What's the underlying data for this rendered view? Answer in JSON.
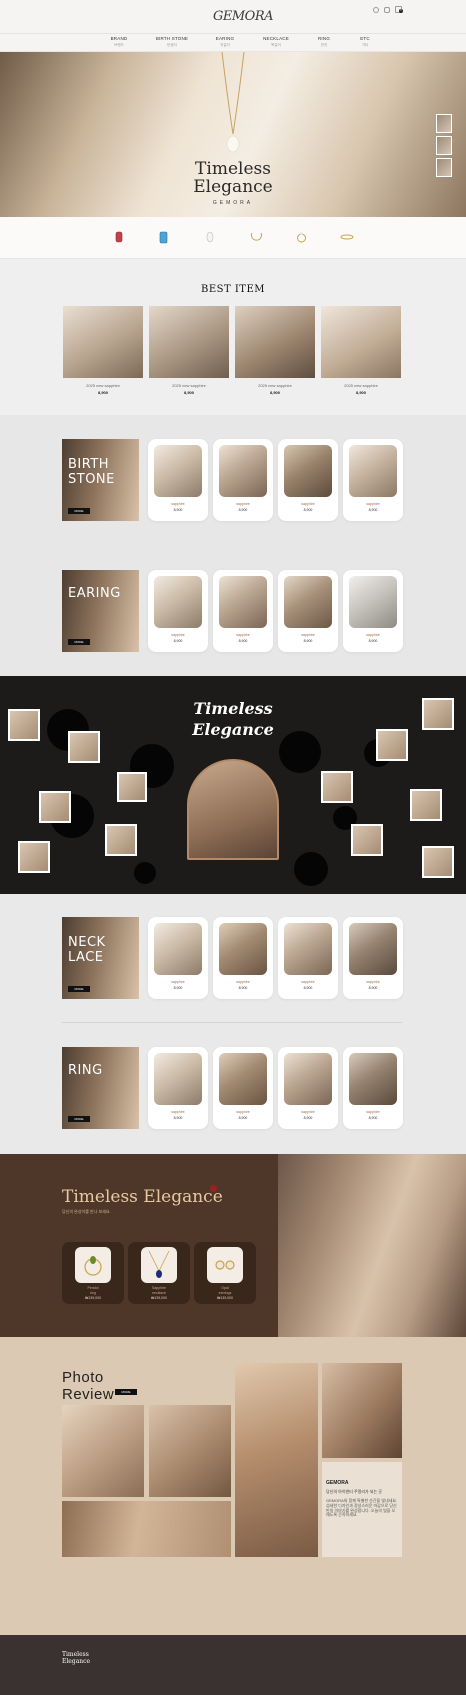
{
  "header": {
    "logo": "GEMORA",
    "cart_count": "0",
    "nav": [
      {
        "label": "BRAND",
        "sub": "브랜드"
      },
      {
        "label": "BIRTH STONE",
        "sub": "탄생석"
      },
      {
        "label": "EARING",
        "sub": "귀걸이"
      },
      {
        "label": "NECKLACE",
        "sub": "목걸이"
      },
      {
        "label": "RING",
        "sub": "반지"
      },
      {
        "label": "ETC",
        "sub": "기타"
      }
    ]
  },
  "hero": {
    "title_line1": "Timeless",
    "title_line2": "Elegance",
    "subtitle": "GEMORA"
  },
  "best": {
    "title": "BEST ITEM",
    "items": [
      {
        "name": "2025 new sapphire",
        "price": "8,900"
      },
      {
        "name": "2025 new sapphire",
        "price": "8,900"
      },
      {
        "name": "2025 new sapphire",
        "price": "8,900"
      },
      {
        "name": "2025 new sapphire",
        "price": "8,900"
      }
    ]
  },
  "categories": [
    {
      "title_line1": "BIRTH",
      "title_line2": "STONE",
      "more": "MORE",
      "items": [
        {
          "name": "sapphire",
          "price": "8,900"
        },
        {
          "name": "sapphire",
          "price": "8,900"
        },
        {
          "name": "sapphire",
          "price": "8,900"
        },
        {
          "name": "sapphire",
          "price": "8,900"
        }
      ]
    },
    {
      "title_line1": "EARING",
      "title_line2": "",
      "more": "MORE",
      "items": [
        {
          "name": "sapphire",
          "price": "8,900"
        },
        {
          "name": "sapphire",
          "price": "8,900"
        },
        {
          "name": "sapphire",
          "price": "8,900"
        },
        {
          "name": "sapphire",
          "price": "8,900"
        }
      ]
    },
    {
      "title_line1": "NECK",
      "title_line2": "LACE",
      "more": "MORE",
      "items": [
        {
          "name": "sapphire",
          "price": "8,900"
        },
        {
          "name": "sapphire",
          "price": "8,900"
        },
        {
          "name": "sapphire",
          "price": "8,900"
        },
        {
          "name": "sapphire",
          "price": "8,900"
        }
      ]
    },
    {
      "title_line1": "RING",
      "title_line2": "",
      "more": "MORE",
      "items": [
        {
          "name": "sapphire",
          "price": "8,900"
        },
        {
          "name": "sapphire",
          "price": "8,900"
        },
        {
          "name": "sapphire",
          "price": "8,900"
        },
        {
          "name": "sapphire",
          "price": "8,900"
        }
      ]
    }
  ],
  "dark_band": {
    "title_line1": "Timeless",
    "title_line2": "Elegance"
  },
  "promo": {
    "title": "Timeless Elegance",
    "subtitle": "당신의 완성이를 만나 보세요.",
    "items": [
      {
        "name_line1": "Peridot",
        "name_line2": "ring",
        "price": "₩139,000"
      },
      {
        "name_line1": "Sapphire",
        "name_line2": "necklace",
        "price": "₩139,000"
      },
      {
        "name_line1": "Opal",
        "name_line2": "earrings",
        "price": "₩139,000"
      }
    ]
  },
  "review": {
    "title_line1": "Photo",
    "title_line2": "Review",
    "more": "MORE",
    "brand": "GEMORA",
    "headline": "당신의 아이덴티 주얼리가 되는 곳",
    "body": "GEMORA와 함께 특별한 순간을 빛내세요. 섬세한 디자인과 정성스러운 마감으로 당신만의 이야기를 완성합니다. 오늘의 빛을 오래도록 간직하세요."
  },
  "footer": {
    "logo_line1": "Timeless",
    "logo_line2": "Elegance"
  },
  "colors": {
    "accent": "#e8c9a2",
    "dark": "#1c1b1a",
    "brown": "#4e3729",
    "footer": "#3a3131",
    "review_bg": "#dbc9b4"
  }
}
